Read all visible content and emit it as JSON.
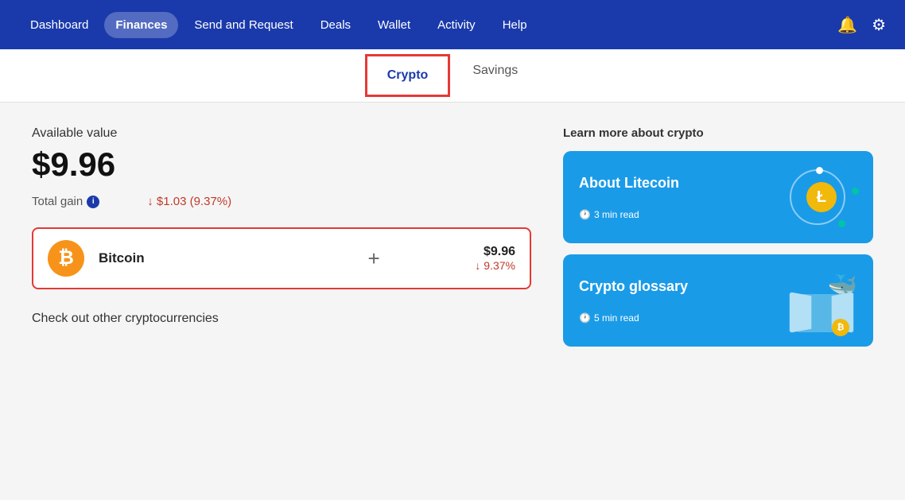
{
  "nav": {
    "items": [
      {
        "label": "Dashboard",
        "active": false
      },
      {
        "label": "Finances",
        "active": true
      },
      {
        "label": "Send and Request",
        "active": false
      },
      {
        "label": "Deals",
        "active": false
      },
      {
        "label": "Wallet",
        "active": false
      },
      {
        "label": "Activity",
        "active": false
      },
      {
        "label": "Help",
        "active": false
      }
    ]
  },
  "subtabs": [
    {
      "label": "Crypto",
      "active": true
    },
    {
      "label": "Savings",
      "active": false
    }
  ],
  "left": {
    "available_label": "Available value",
    "available_value": "$9.96",
    "total_gain_label": "Total gain",
    "total_gain_value": "↓ $1.03 (9.37%)",
    "coin_name": "Bitcoin",
    "coin_usd": "$9.96",
    "coin_pct": "↓ 9.37%",
    "check_other": "Check out other cryptocurrencies"
  },
  "right": {
    "learn_label": "Learn more about crypto",
    "card1": {
      "title": "About Litecoin",
      "time": "3 min read"
    },
    "card2": {
      "title": "Crypto glossary",
      "time": "5 min read"
    }
  }
}
